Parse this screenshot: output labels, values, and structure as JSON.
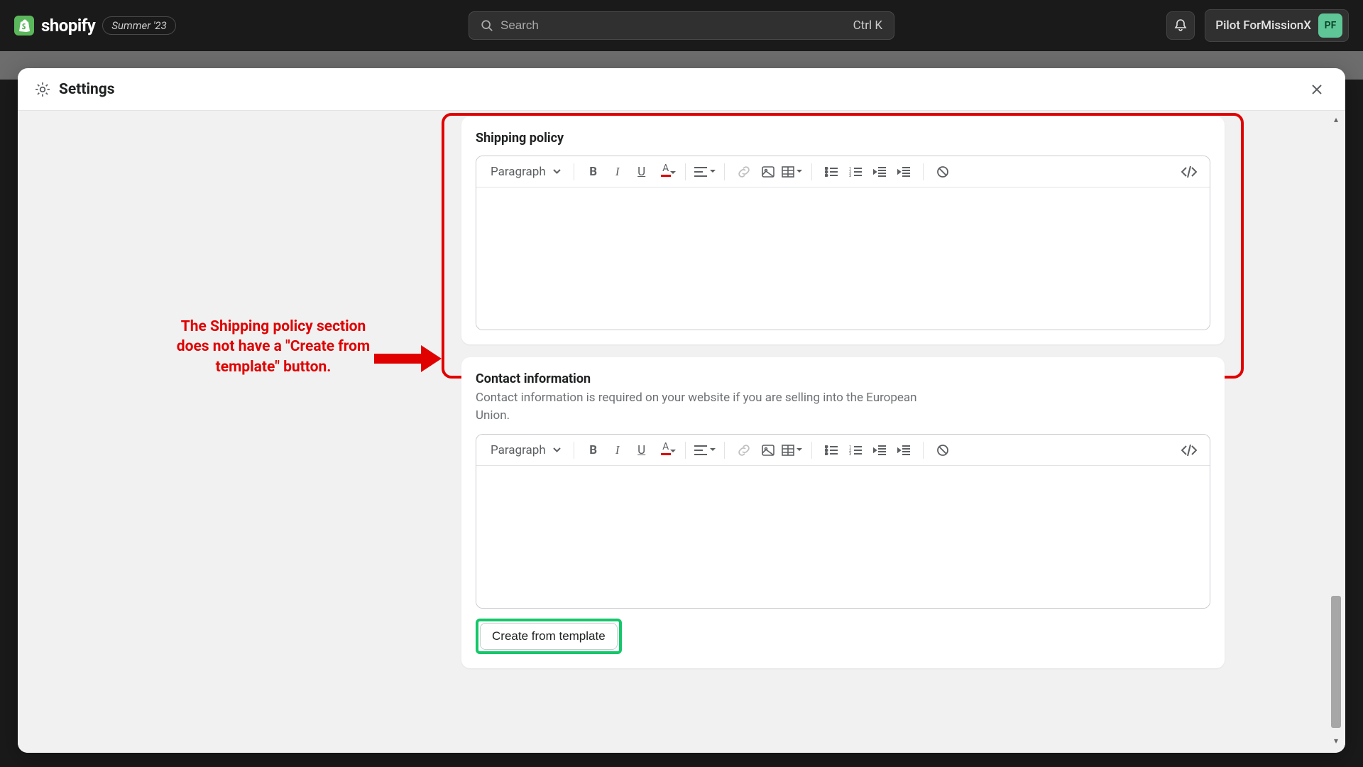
{
  "topbar": {
    "brand": "shopify",
    "badge": "Summer '23",
    "search_placeholder": "Search",
    "search_kbd": "Ctrl K",
    "user_name": "Pilot ForMissionX",
    "user_initials": "PF"
  },
  "modal": {
    "title": "Settings"
  },
  "annotation": {
    "text": "The Shipping policy section does not have a \"Create from template\" button."
  },
  "cards": {
    "shipping": {
      "title": "Shipping policy"
    },
    "contact": {
      "title": "Contact information",
      "subtitle": "Contact information is required on your website if you are selling into the European Union.",
      "button": "Create from template"
    }
  },
  "editor": {
    "format": "Paragraph"
  },
  "colors": {
    "accent_red": "#e00000",
    "accent_green": "#14c76a"
  }
}
